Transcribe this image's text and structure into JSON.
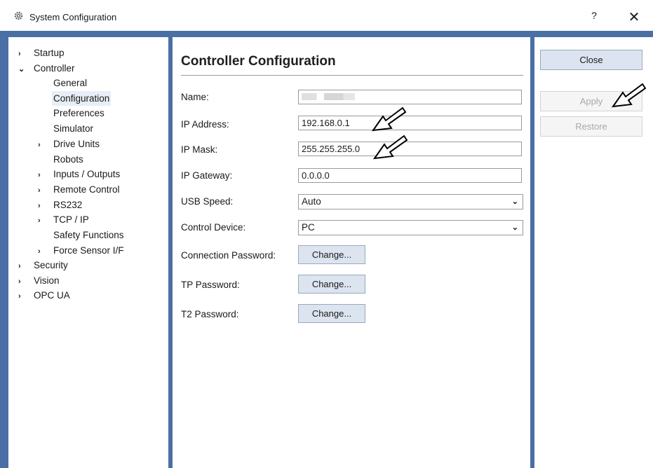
{
  "window": {
    "title": "System Configuration",
    "help_label": "?",
    "close_label": "✕",
    "icon": "gear-icon"
  },
  "tree": {
    "items": [
      {
        "label": "Startup",
        "chevron": "›",
        "icon": "chevron-right-icon"
      },
      {
        "label": "Controller",
        "chevron": "⌄",
        "icon": "chevron-down-icon"
      },
      {
        "label": "General"
      },
      {
        "label": "Configuration",
        "selected": true
      },
      {
        "label": "Preferences"
      },
      {
        "label": "Simulator"
      },
      {
        "label": "Drive Units",
        "chevron": "›",
        "icon": "chevron-right-icon"
      },
      {
        "label": "Robots"
      },
      {
        "label": "Inputs / Outputs",
        "chevron": "›",
        "icon": "chevron-right-icon"
      },
      {
        "label": "Remote Control",
        "chevron": "›",
        "icon": "chevron-right-icon"
      },
      {
        "label": "RS232",
        "chevron": "›",
        "icon": "chevron-right-icon"
      },
      {
        "label": "TCP / IP",
        "chevron": "›",
        "icon": "chevron-right-icon"
      },
      {
        "label": "Safety Functions"
      },
      {
        "label": "Force Sensor I/F",
        "chevron": "›",
        "icon": "chevron-right-icon"
      },
      {
        "label": "Security",
        "chevron": "›",
        "icon": "chevron-right-icon"
      },
      {
        "label": "Vision",
        "chevron": "›",
        "icon": "chevron-right-icon"
      },
      {
        "label": "OPC UA",
        "chevron": "›",
        "icon": "chevron-right-icon"
      }
    ]
  },
  "form": {
    "heading": "Controller Configuration",
    "name_label": "Name:",
    "ip_label": "IP Address:",
    "ip_value": "192.168.0.1",
    "mask_label": "IP Mask:",
    "mask_value": "255.255.255.0",
    "gateway_label": "IP Gateway:",
    "gateway_value": "0.0.0.0",
    "usb_label": "USB Speed:",
    "usb_value": "Auto",
    "device_label": "Control Device:",
    "device_value": "PC",
    "conn_pw_label": "Connection Password:",
    "tp_pw_label": "TP Password:",
    "t2_pw_label": "T2 Password:",
    "change_label": "Change..."
  },
  "actions": {
    "close_label": "Close",
    "apply_label": "Apply",
    "restore_label": "Restore"
  },
  "colors": {
    "frame": "#4a6fa5",
    "button": "#dce4ef",
    "selected": "#e8eef6",
    "disabled_text": "#a8a8a8"
  }
}
